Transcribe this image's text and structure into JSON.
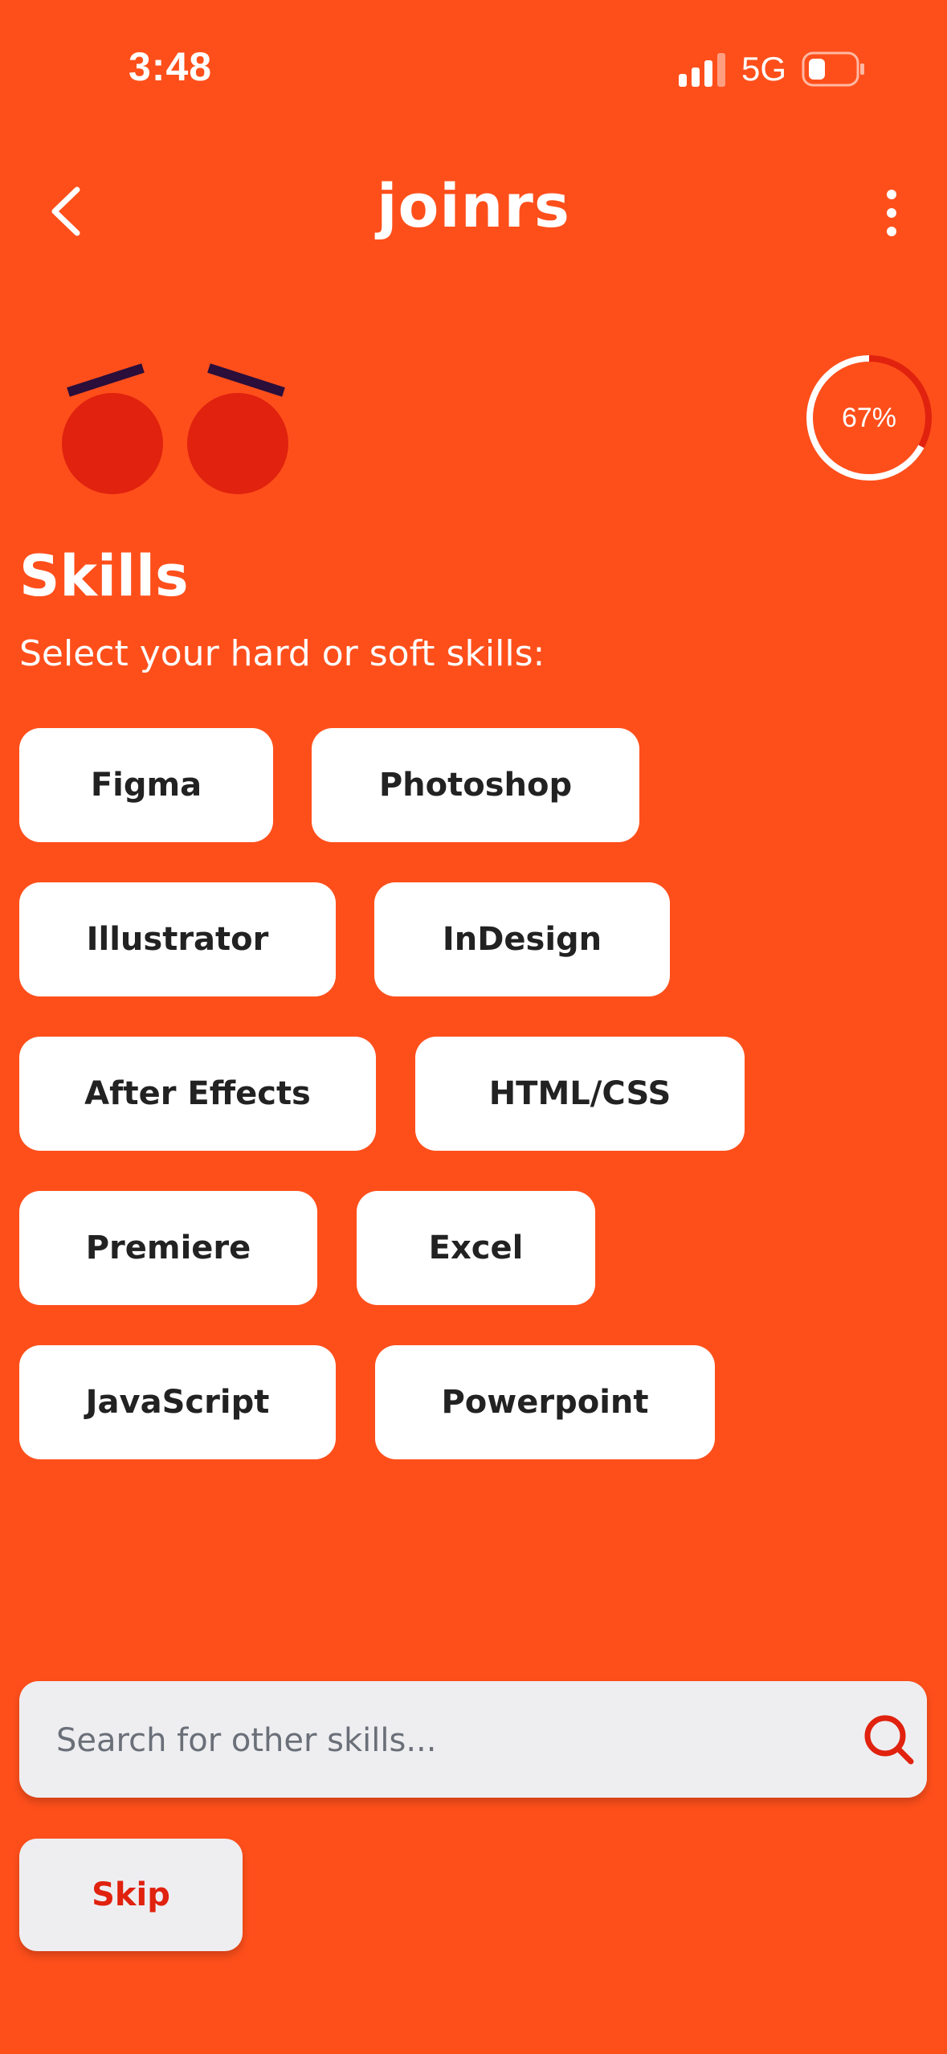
{
  "status_bar": {
    "time": "3:48",
    "network": "5G",
    "signal_icon": "cellular-signal-icon",
    "battery_icon": "battery-low-icon"
  },
  "nav": {
    "back_icon": "chevron-left-icon",
    "logo": "joinrs",
    "more_icon": "more-vertical-icon"
  },
  "progress": {
    "label": "67%",
    "value": 0.67,
    "track_color": "#FFFFFF",
    "fill_color": "#E0220E"
  },
  "header": {
    "title": "Skills",
    "subtitle": "Select your hard or soft skills:"
  },
  "skills": [
    "Figma",
    "Photoshop",
    "Illustrator",
    "InDesign",
    "After Effects",
    "HTML/CSS",
    "Premiere",
    "Excel",
    "JavaScript",
    "Powerpoint"
  ],
  "search": {
    "placeholder": "Search for other skills...",
    "value": "",
    "icon": "search-icon"
  },
  "skip_label": "Skip",
  "colors": {
    "background": "#FE4F1B",
    "accent": "#E0220E",
    "mascot_brow": "#2B0E3A",
    "surface": "#EEEEF1"
  }
}
